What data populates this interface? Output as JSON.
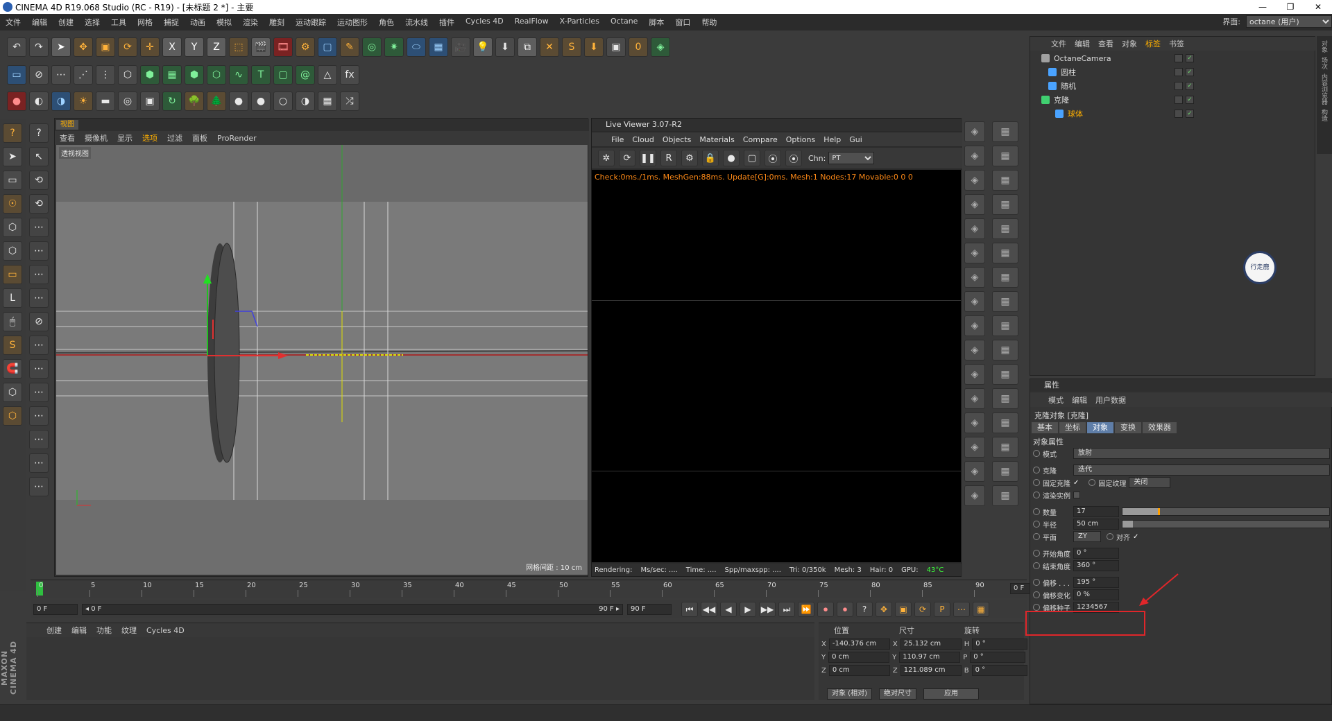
{
  "window": {
    "title": "CINEMA 4D R19.068 Studio (RC - R19) - [未标题 2 *] - 主要",
    "min": "—",
    "max": "❐",
    "close": "✕"
  },
  "menubar": {
    "items": [
      "文件",
      "编辑",
      "创建",
      "选择",
      "工具",
      "网格",
      "捕捉",
      "动画",
      "模拟",
      "渲染",
      "雕刻",
      "运动跟踪",
      "运动图形",
      "角色",
      "流水线",
      "插件",
      "Cycles 4D",
      "RealFlow",
      "X-Particles",
      "Octane",
      "脚本",
      "窗口",
      "帮助"
    ],
    "layout_label": "界面:",
    "layout_value": "octane (用户)"
  },
  "toolbar_icons": {
    "row1": [
      "undo-icon",
      "redo-icon",
      "select-arrow-icon",
      "move-icon",
      "scale-icon",
      "rotate-icon",
      "live-move-icon",
      "x-axis-icon",
      "y-axis-icon",
      "z-axis-icon",
      "coordinate-system-icon",
      "render-view-icon",
      "render-picture-viewer-icon",
      "render-settings-icon",
      "cube-icon",
      "pen-icon",
      "subdivision-icon",
      "cloner-icon",
      "deformer-icon",
      "floor-icon",
      "camera-icon",
      "light-icon",
      "download-icon",
      "tags-icon",
      "cross-icon",
      "script-s-icon",
      "cut-icon",
      "frame-icon",
      "psr-icon",
      "plugin-icon"
    ],
    "row1_glyphs": [
      "↶",
      "↷",
      "➤",
      "✥",
      "▣",
      "⟳",
      "✛",
      "X",
      "Y",
      "Z",
      "⬚",
      "🎬",
      "🎞",
      "⚙",
      "▢",
      "✎",
      "◎",
      "✷",
      "⬭",
      "▦",
      "🎥",
      "💡",
      "⬇",
      "⧉",
      "✕",
      "S",
      "⬇",
      "▣",
      "0",
      "◈"
    ],
    "row2": [
      "model-mode-icon",
      "gravity-icon",
      "points-icon",
      "edges-icon",
      "polygons-icon",
      "selection-icon",
      "hexagon-icon",
      "grid-icon",
      "cube-green-icon",
      "cube-outline-icon",
      "spline-icon",
      "text-icon",
      "box-icon",
      "spiral-icon",
      "pyramid-icon",
      "fx-icon"
    ],
    "row2_glyphs": [
      "▭",
      "⊘",
      "⋯",
      "⋰",
      "⋮",
      "⬡",
      "⬢",
      "▦",
      "⬢",
      "⬡",
      "∿",
      "T",
      "▢",
      "@",
      "△",
      "fx"
    ],
    "row3": [
      "octane-live-viewer-icon",
      "sphere-half-icon",
      "sphere-blue-icon",
      "sun-icon",
      "rect-light-icon",
      "target-icon",
      "cup-icon",
      "refresh-icon",
      "tree-icon",
      "tree2-icon",
      "sphere-grey-icon",
      "sphere-grey2-icon",
      "sphere-white-icon",
      "sphere-dark-icon",
      "checker-icon",
      "shuffle-icon"
    ],
    "row3_glyphs": [
      "●",
      "◐",
      "◑",
      "☀",
      "▬",
      "◎",
      "▣",
      "↻",
      "🌳",
      "🌲",
      "●",
      "●",
      "○",
      "◑",
      "▦",
      "⤮"
    ],
    "psr_value": "0"
  },
  "left_tools": {
    "glyphs": [
      "?",
      "➤",
      "▭",
      "☉",
      "⬡",
      "⬡",
      "▭",
      "L",
      "🖱",
      "S",
      "🧲",
      "⬡",
      "⬡"
    ],
    "glyphs2": [
      "?",
      "↖",
      "⟲",
      "⟲",
      "⋯",
      "⋯",
      "⋯",
      "⋯",
      "⊘",
      "⋯",
      "⋯",
      "⋯",
      "⋯",
      "⋯",
      "⋯",
      "⋯"
    ]
  },
  "viewport": {
    "tab": "视图",
    "menu": [
      "查看",
      "摄像机",
      "显示",
      "选项",
      "过滤",
      "面板",
      "ProRender"
    ],
    "active_menu": "选项",
    "label": "透视视图",
    "grid_spacing": "网格间距 : 10 cm"
  },
  "live_viewer": {
    "title": "Live Viewer 3.07-R2",
    "menu": [
      "File",
      "Cloud",
      "Objects",
      "Materials",
      "Compare",
      "Options",
      "Help",
      "Gui"
    ],
    "chn_label": "Chn:",
    "chn_value": "PT",
    "log": "Check:0ms./1ms. MeshGen:88ms. Update[G]:0ms. Mesh:1 Nodes:17 Movable:0  0 0",
    "status": [
      "Rendering:",
      "Ms/sec: ....",
      "Time: ....",
      "Spp/maxspp: ....",
      "Tri: 0/350k",
      "Mesh: 3",
      "Hair: 0",
      "GPU:"
    ],
    "gpu_temp": "43°C",
    "tool_glyphs": [
      "✲",
      "⟳",
      "❚❚",
      "R",
      "⚙",
      "🔒",
      "●",
      "▢",
      "⦿",
      "⦿"
    ]
  },
  "timeline": {
    "ticks": [
      "0",
      "5",
      "10",
      "15",
      "20",
      "25",
      "30",
      "35",
      "40",
      "45",
      "50",
      "55",
      "60",
      "65",
      "70",
      "75",
      "80",
      "85",
      "90"
    ],
    "current_frame": "0 F"
  },
  "transport": {
    "start": "0 F",
    "range_start": "◂ 0 F",
    "range_end": "90 F ▸",
    "end": "90 F",
    "glyphs": [
      "⏮",
      "◀◀",
      "◀",
      "▶",
      "▶▶",
      "⏭",
      "⏩",
      "⏺",
      "⏺",
      "?",
      "✥",
      "▣",
      "⟳",
      "P",
      "⋯",
      "▦"
    ]
  },
  "material_panel": {
    "menu": [
      "创建",
      "编辑",
      "功能",
      "纹理",
      "Cycles 4D"
    ],
    "maxon": "MAXON CINEMA 4D"
  },
  "coordinates": {
    "headers": [
      "位置",
      "尺寸",
      "旋转"
    ],
    "rows": [
      {
        "axis": "X",
        "pos": "-140.376 cm",
        "size_axis": "X",
        "size": "25.132 cm",
        "rot_axis": "H",
        "rot": "0 °"
      },
      {
        "axis": "Y",
        "pos": "0 cm",
        "size_axis": "Y",
        "size": "110.97 cm",
        "rot_axis": "P",
        "rot": "0 °"
      },
      {
        "axis": "Z",
        "pos": "0 cm",
        "size_axis": "Z",
        "size": "121.089 cm",
        "rot_axis": "B",
        "rot": "0 °"
      }
    ],
    "mode1": "对象 (相对)",
    "mode2": "绝对尺寸",
    "apply": "应用"
  },
  "object_manager": {
    "menu": [
      "文件",
      "编辑",
      "查看",
      "对象",
      "标签",
      "书签"
    ],
    "active_menu": "标签",
    "objects": [
      {
        "name": "OctaneCamera",
        "color": "#a0a0a0",
        "indent": 0
      },
      {
        "name": "圆柱",
        "color": "#4aa3ff",
        "indent": 1
      },
      {
        "name": "随机",
        "color": "#4aa3ff",
        "indent": 1
      },
      {
        "name": "克隆",
        "color": "#40d070",
        "indent": 0
      },
      {
        "name": "球体",
        "color": "#4aa3ff",
        "indent": 2
      }
    ]
  },
  "watermark": "行走鹿",
  "side_tabs": [
    "对象",
    "场次",
    "内容浏览器",
    "构造"
  ],
  "attributes": {
    "title": "属性",
    "menu": [
      "模式",
      "编辑",
      "用户数据"
    ],
    "object_title": "克隆对象 [克隆]",
    "tabs": [
      "基本",
      "坐标",
      "对象",
      "变换",
      "效果器"
    ],
    "active_tab": "对象",
    "section": "对象属性",
    "mode_label": "模式",
    "mode_value": "放射",
    "clone_label": "克隆",
    "clone_value": "迭代",
    "fixed_clone_label": "固定克隆",
    "fixed_texture_label": "固定纹理",
    "fixed_texture_value": "关闭",
    "render_instance_label": "渲染实例",
    "count_label": "数量",
    "count_value": "17",
    "count_fraction": 0.17,
    "radius_label": "半径",
    "radius_value": "50 cm",
    "radius_fraction": 0.05,
    "plane_label": "平面",
    "plane_value": "ZY",
    "align_label": "对齐",
    "start_angle_label": "开始角度",
    "start_angle_value": "0 °",
    "end_angle_label": "结束角度",
    "end_angle_value": "360 °",
    "offset_label": "偏移 . . .",
    "offset_value": "195 °",
    "offset_var_label": "偏移变化",
    "offset_var_value": "0 %",
    "offset_seed_label": "偏移种子",
    "offset_seed_value": "1234567"
  }
}
